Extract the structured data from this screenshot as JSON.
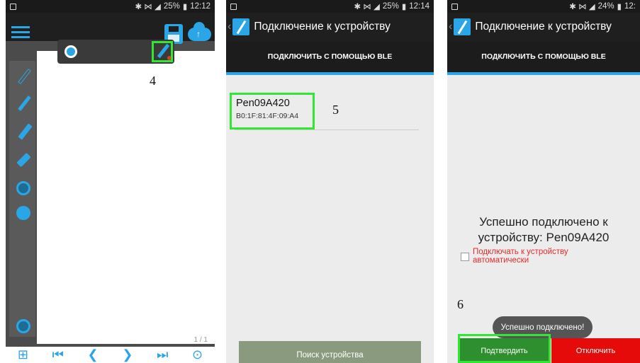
{
  "screen1": {
    "status": {
      "battery": "25%",
      "time": "12:12"
    },
    "step_label": "4",
    "page_indicator": "1 / 1",
    "bottom_nav": [
      "⊞",
      "⏮",
      "❮",
      "❯",
      "⏭",
      "⊙"
    ]
  },
  "screen2": {
    "status": {
      "battery": "25%",
      "time": "12:14"
    },
    "title": "Подключение к устройству",
    "tab": "ПОДКЛЮЧИТЬ С ПОМОЩЬЮ BLE",
    "device_name": "Pen09A420",
    "device_mac": "B0:1F:81:4F:09:A4",
    "step_label": "5",
    "search_button": "Поиск устройства"
  },
  "screen3": {
    "status": {
      "battery": "24%",
      "time": "12:"
    },
    "title": "Подключение к устройству",
    "tab": "ПОДКЛЮЧИТЬ С ПОМОЩЬЮ BLE",
    "message_line1": "Успешно подключено к",
    "message_line2": "устройству: Pen09A420",
    "auto_connect_label": "Подключать к устройству автоматически",
    "step_label": "6",
    "toast": "Успешно подключено!",
    "confirm_button": "Подтвердить",
    "disconnect_button": "Отключить"
  },
  "colors": {
    "accent": "#2aa5e5",
    "highlight": "#34e634",
    "danger": "#e50b0b",
    "confirm": "#2e8f2e"
  }
}
